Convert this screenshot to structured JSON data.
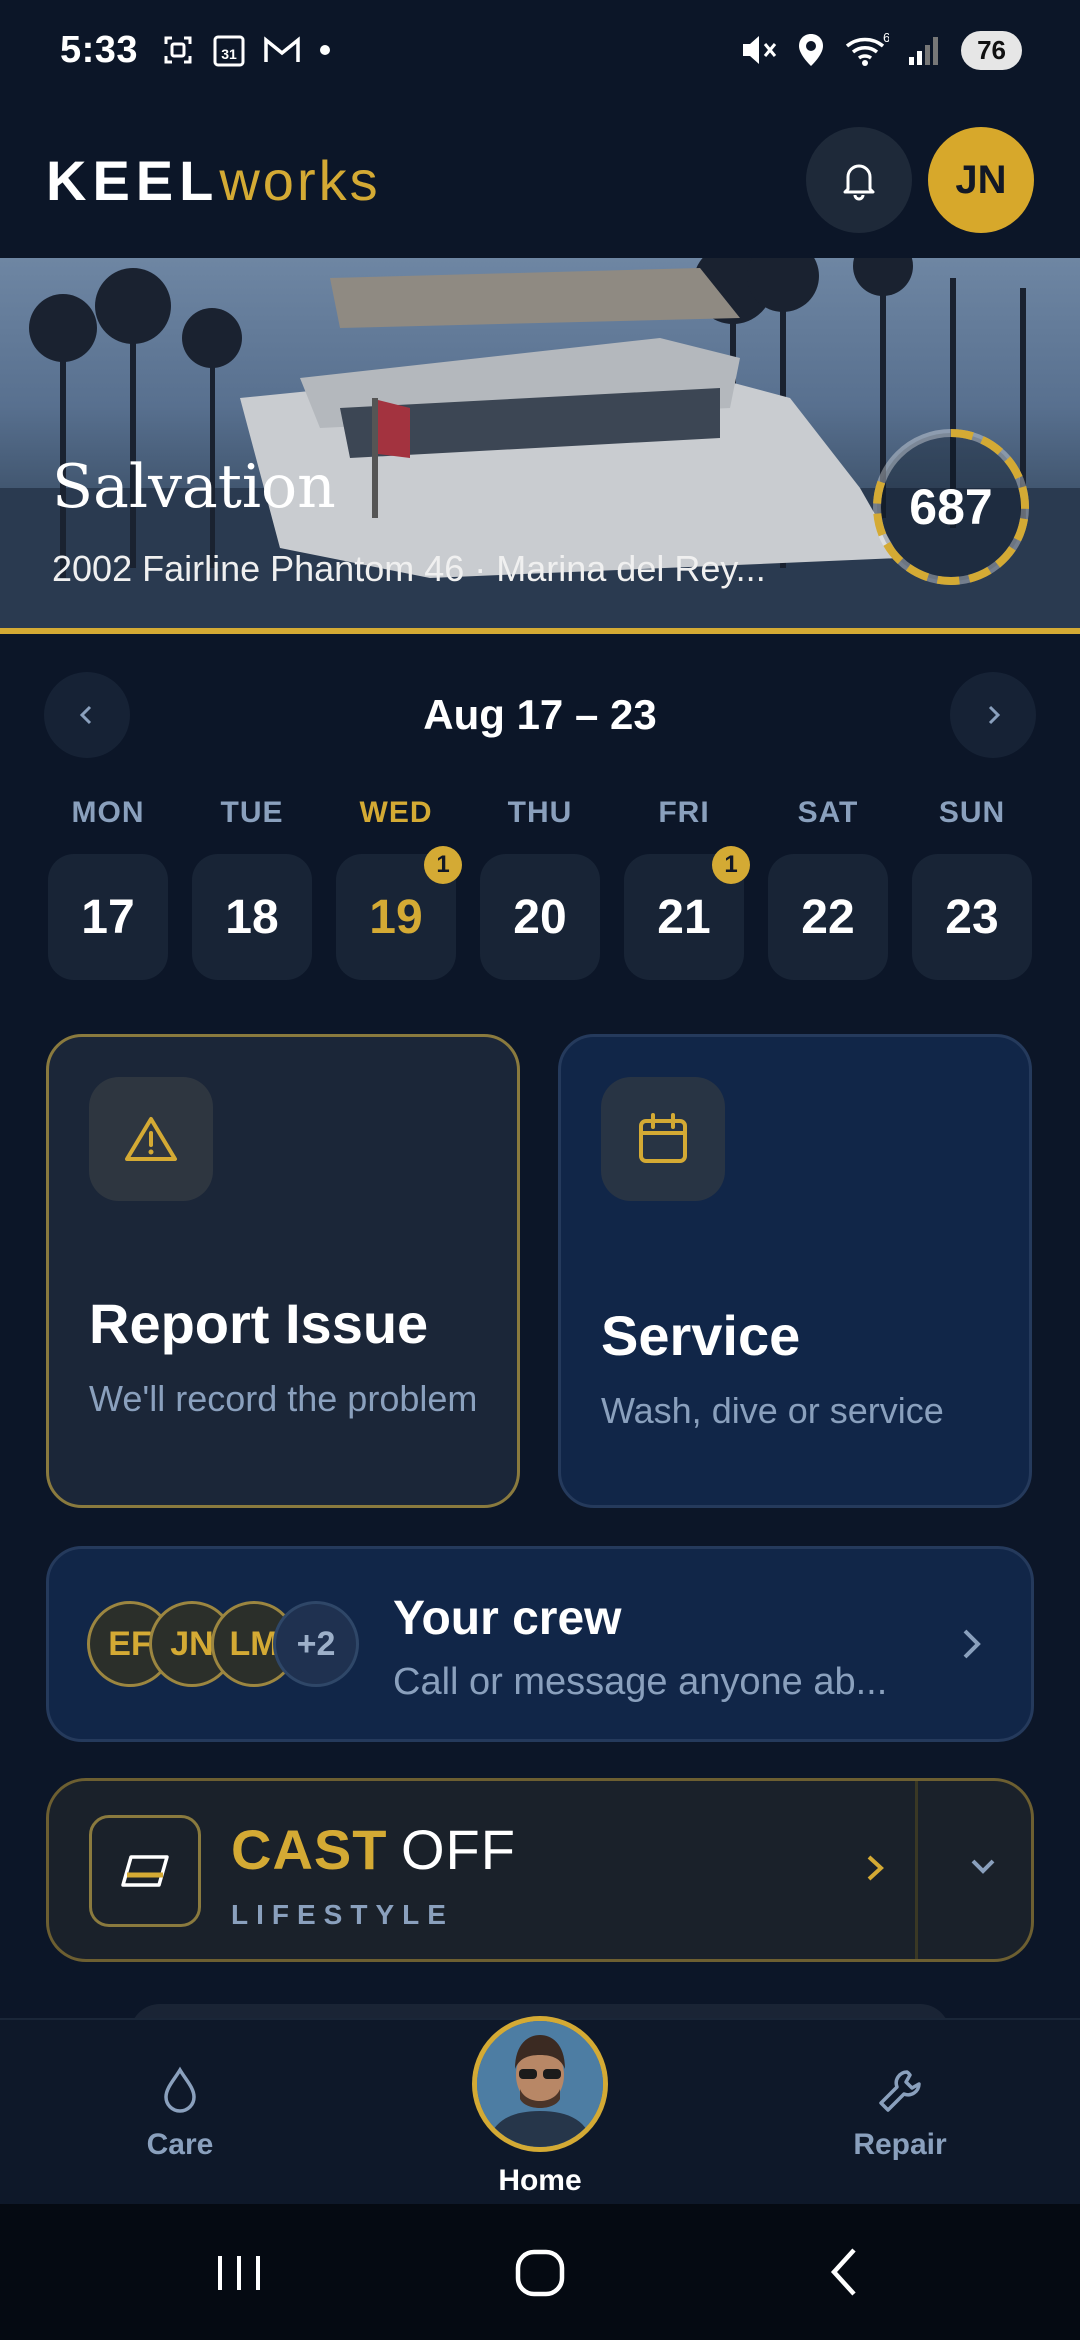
{
  "status_bar": {
    "time": "5:33",
    "battery": "76",
    "network": "6"
  },
  "header": {
    "logo_part1": "KEEL",
    "logo_part2": "works",
    "user_initials": "JN"
  },
  "hero": {
    "boat_name": "Salvation",
    "boat_info": "2002 Fairline Phantom 46 · Marina del Rey...",
    "score": "687",
    "score_fraction": 0.85
  },
  "week": {
    "label": "Aug 17 – 23",
    "days": [
      {
        "name": "MON",
        "num": "17",
        "badge": ""
      },
      {
        "name": "TUE",
        "num": "18",
        "badge": ""
      },
      {
        "name": "WED",
        "num": "19",
        "badge": "1"
      },
      {
        "name": "THU",
        "num": "20",
        "badge": ""
      },
      {
        "name": "FRI",
        "num": "21",
        "badge": "1"
      },
      {
        "name": "SAT",
        "num": "22",
        "badge": ""
      },
      {
        "name": "SUN",
        "num": "23",
        "badge": ""
      }
    ]
  },
  "cards": {
    "report": {
      "title": "Report Issue",
      "subtitle": "We'll record the problem",
      "icon": "warning-icon"
    },
    "service": {
      "title": "Service",
      "subtitle": "Wash, dive or service",
      "icon": "calendar-icon"
    }
  },
  "crew": {
    "title": "Your crew",
    "subtitle": "Call or message anyone ab...",
    "avatars": [
      "EF",
      "JN",
      "LM"
    ],
    "more": "+2"
  },
  "castoff": {
    "word1": "CAST",
    "word2": "OFF",
    "tag": "LIFESTYLE"
  },
  "bottom_nav": {
    "care": "Care",
    "home": "Home",
    "repair": "Repair"
  },
  "colors": {
    "accent": "#d4aa34",
    "background": "#0c1628",
    "muted": "#8aa0bd"
  }
}
